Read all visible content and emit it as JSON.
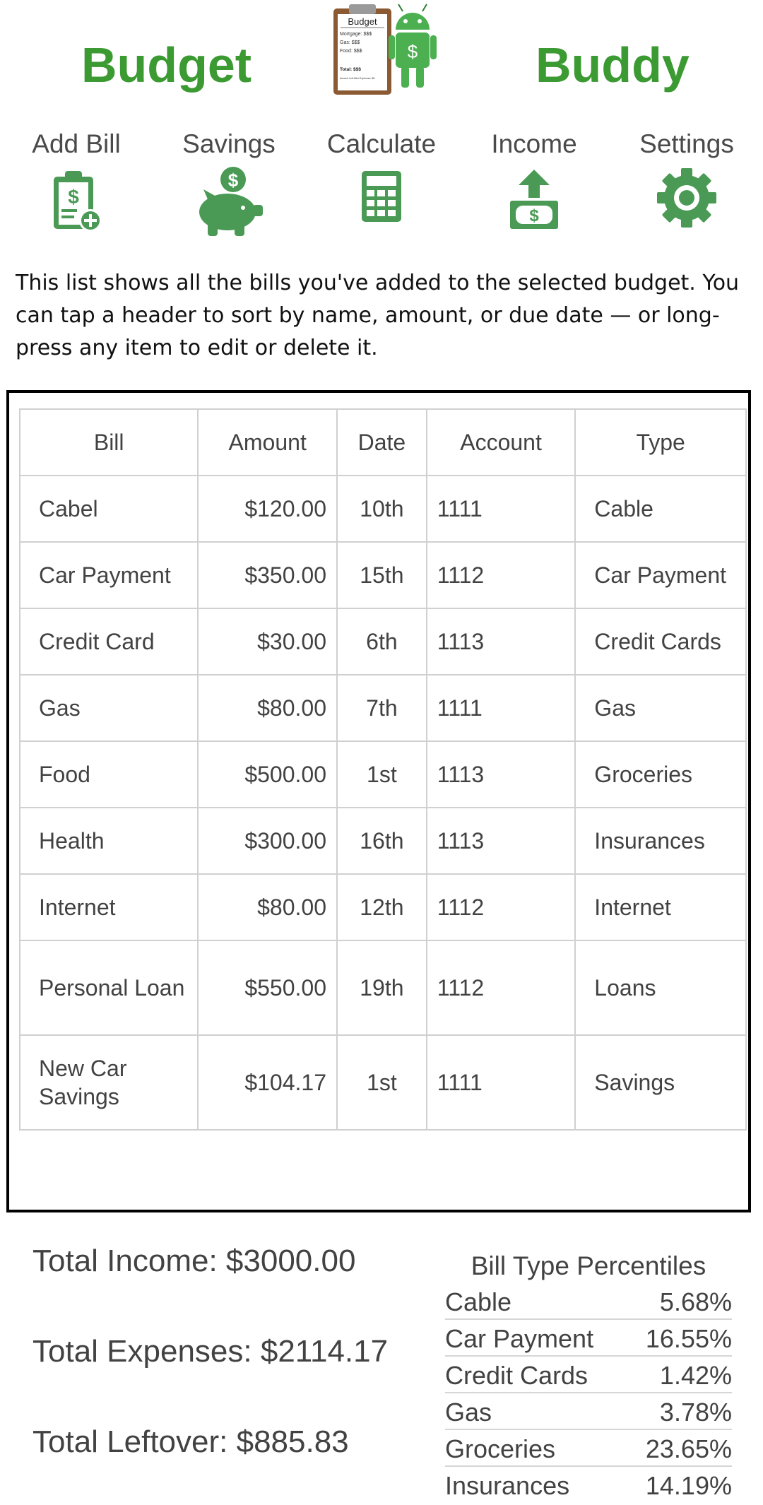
{
  "header": {
    "brand_left": "Budget",
    "brand_right": "Buddy",
    "logo": {
      "clipboard_title": "Budget",
      "lines": [
        "Mortgage: $$$",
        "Gas:      $$$",
        "Food:     $$$"
      ],
      "total": "Total: $$$",
      "footer": "Amount Left After Expenses: $$",
      "coin_symbol": "$"
    }
  },
  "nav": {
    "items": [
      {
        "label": "Add Bill",
        "icon": "add-bill-icon"
      },
      {
        "label": "Savings",
        "icon": "piggy-bank-icon"
      },
      {
        "label": "Calculate",
        "icon": "calculator-icon"
      },
      {
        "label": "Income",
        "icon": "income-icon"
      },
      {
        "label": "Settings",
        "icon": "gear-icon"
      }
    ],
    "icon_color": "#4a9a55"
  },
  "description": "This list shows all the bills you've added to the selected budget. You can tap a header to sort by name, amount, or due date — or long-press any item to edit or delete it.",
  "table": {
    "headers": [
      "Bill",
      "Amount",
      "Date",
      "Account",
      "Type"
    ],
    "rows": [
      [
        "Cabel",
        "$120.00",
        "10th",
        "1111",
        "Cable"
      ],
      [
        "Car Payment",
        "$350.00",
        "15th",
        "1112",
        "Car Payment"
      ],
      [
        "Credit Card",
        "$30.00",
        "6th",
        "1113",
        "Credit Cards"
      ],
      [
        "Gas",
        "$80.00",
        "7th",
        "1111",
        "Gas"
      ],
      [
        "Food",
        "$500.00",
        "1st",
        "1113",
        "Groceries"
      ],
      [
        "Health",
        "$300.00",
        "16th",
        "1113",
        "Insurances"
      ],
      [
        "Internet",
        "$80.00",
        "12th",
        "1112",
        "Internet"
      ],
      [
        "Personal Loan",
        "$550.00",
        "19th",
        "1112",
        "Loans"
      ],
      [
        "New Car Savings",
        "$104.17",
        "1st",
        "1111",
        "Savings"
      ]
    ]
  },
  "totals": {
    "income": "Total Income: $3000.00",
    "expenses": "Total Expenses: $2114.17",
    "leftover": "Total Leftover: $885.83"
  },
  "percentiles": {
    "title": "Bill Type Percentiles",
    "rows": [
      {
        "type": "Cable",
        "pct": "5.68%"
      },
      {
        "type": "Car Payment",
        "pct": "16.55%"
      },
      {
        "type": "Credit Cards",
        "pct": "1.42%"
      },
      {
        "type": "Gas",
        "pct": "3.78%"
      },
      {
        "type": "Groceries",
        "pct": "23.65%"
      },
      {
        "type": "Insurances",
        "pct": "14.19%"
      }
    ]
  },
  "colors": {
    "brand_green": "#3b9a32",
    "icon_green": "#4a9a55",
    "border": "#000000"
  }
}
